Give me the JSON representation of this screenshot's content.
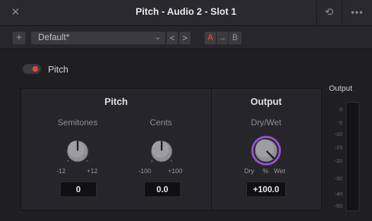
{
  "window": {
    "title": "Pitch - Audio 2 -  Slot 1",
    "close_glyph": "✕",
    "reset_glyph": "⟲",
    "more_glyph": "•••"
  },
  "toolbar": {
    "add_glyph": "+",
    "preset": "Default*",
    "preset_chevron": "⌄",
    "prev": "<",
    "next": ">",
    "ab_a": "A",
    "ab_arrow": "→",
    "ab_b": "B"
  },
  "plugin": {
    "label": "Pitch",
    "enabled": true,
    "accent": "#e8453c"
  },
  "pitch_section": {
    "title": "Pitch",
    "semitones": {
      "label": "Semitones",
      "min": "-12",
      "max": "+12",
      "value": "0",
      "norm": 0.5
    },
    "cents": {
      "label": "Cents",
      "min": "-100",
      "max": "+100",
      "value": "0.0",
      "norm": 0.5
    }
  },
  "output_section": {
    "title": "Output",
    "drywet": {
      "label": "Dry/Wet",
      "left": "Dry",
      "unit": "%",
      "right": "Wet",
      "value": "+100.0",
      "norm": 1.0,
      "ring_color": "#9b4fd6"
    }
  },
  "meter": {
    "title": "Output",
    "ticks": [
      "0",
      "-5",
      "-10",
      "-15",
      "-20",
      "-30",
      "-40",
      "-50"
    ]
  }
}
